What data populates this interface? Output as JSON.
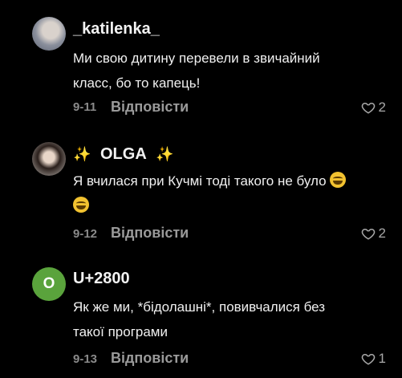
{
  "comments": [
    {
      "username": "_katilenka_",
      "text_line1": "Ми свою дитину перевели в звичайний",
      "text_line2": "класс, бо то капець!",
      "date": "9-11",
      "reply_label": "Відповісти",
      "likes": "2"
    },
    {
      "username": "OLGA",
      "sparkle": "✨",
      "text_line1": "Я вчилася при Кучмі тоді такого не було",
      "date": "9-12",
      "reply_label": "Відповісти",
      "likes": "2"
    },
    {
      "username": "U+2800",
      "avatar_letter": "O",
      "text_line1": "Як же ми, *бідолашні*, повивчалися без",
      "text_line2": "такої програми",
      "date": "9-13",
      "reply_label": "Відповісти",
      "likes": "1"
    }
  ],
  "icons": {
    "heart": "heart-outline-icon",
    "emoji": "laughing-emoji-icon"
  },
  "colors": {
    "background": "#000000",
    "avatar_letter_bg": "#5aa33c",
    "sparkle": "#f6d64b"
  }
}
